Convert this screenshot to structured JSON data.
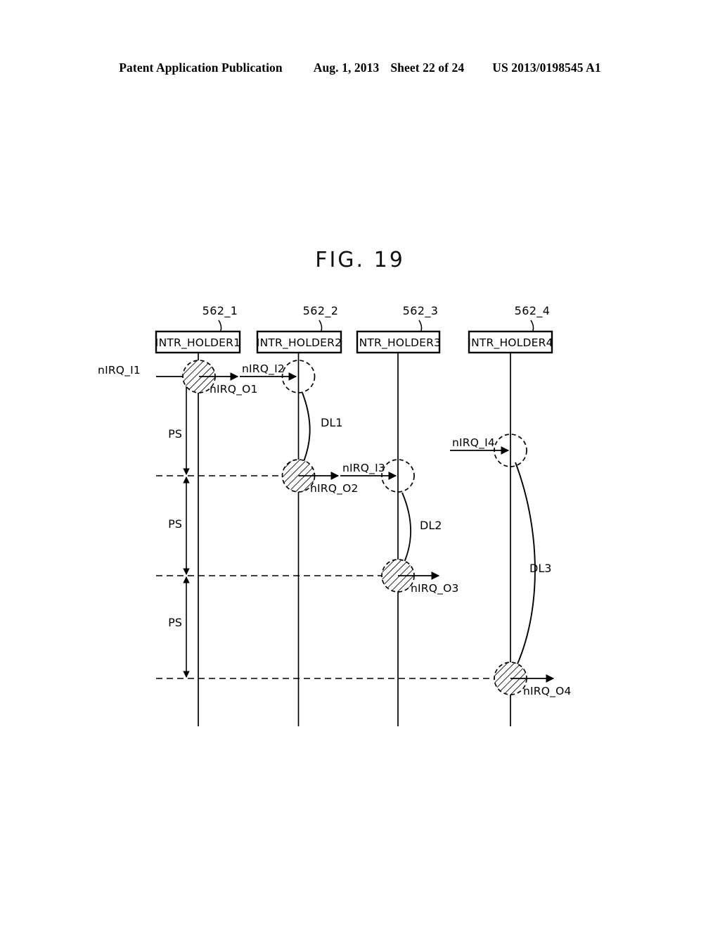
{
  "header": {
    "publication": "Patent Application Publication",
    "date": "Aug. 1, 2013",
    "sheet": "Sheet 22 of 24",
    "document_number": "US 2013/0198545 A1"
  },
  "figure": {
    "title": "FIG. 19"
  },
  "diagram": {
    "holders": [
      {
        "label": "INTR_HOLDER1",
        "ref": "562_1"
      },
      {
        "label": "INTR_HOLDER2",
        "ref": "562_2"
      },
      {
        "label": "INTR_HOLDER3",
        "ref": "562_3"
      },
      {
        "label": "INTR_HOLDER4",
        "ref": "562_4"
      }
    ],
    "inputs": [
      {
        "label": "nIRQ_I1"
      },
      {
        "label": "nIRQ_I2"
      },
      {
        "label": "nIRQ_I3"
      },
      {
        "label": "nIRQ_I4"
      }
    ],
    "outputs": [
      {
        "label": "nIRQ_O1"
      },
      {
        "label": "nIRQ_O2"
      },
      {
        "label": "nIRQ_O3"
      },
      {
        "label": "nIRQ_O4"
      }
    ],
    "delays": [
      {
        "label": "DL1"
      },
      {
        "label": "DL2"
      },
      {
        "label": "DL3"
      }
    ],
    "periods": [
      {
        "label": "PS"
      },
      {
        "label": "PS"
      },
      {
        "label": "PS"
      }
    ],
    "colors": {
      "ink": "#000000",
      "paper": "#ffffff"
    }
  }
}
